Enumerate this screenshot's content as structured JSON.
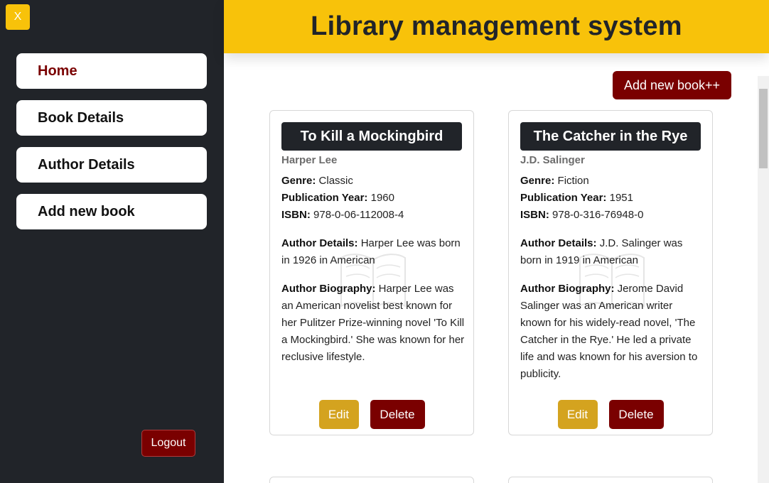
{
  "sidebar": {
    "close_label": "X",
    "items": [
      {
        "label": "Home",
        "active": true
      },
      {
        "label": "Book Details",
        "active": false
      },
      {
        "label": "Author Details",
        "active": false
      },
      {
        "label": "Add new book",
        "active": false
      }
    ],
    "logout_label": "Logout"
  },
  "header": {
    "title": "Library management system"
  },
  "toolbar": {
    "add_book_label": "Add new book++"
  },
  "labels": {
    "genre": "Genre:",
    "year": "Publication Year:",
    "isbn": "ISBN:",
    "author_details": "Author Details:",
    "author_bio": "Author Biography:"
  },
  "books": [
    {
      "title": "To Kill a Mockingbird",
      "author": "Harper Lee",
      "genre": "Classic",
      "year": "1960",
      "isbn": "978-0-06-112008-4",
      "author_details": "Harper Lee was born in 1926 in American",
      "author_bio": "Harper Lee was an American novelist best known for her Pulitzer Prize-winning novel 'To Kill a Mockingbird.' She was known for her reclusive lifestyle.",
      "edit_label": "Edit",
      "delete_label": "Delete"
    },
    {
      "title": "The Catcher in the Rye",
      "author": "J.D. Salinger",
      "genre": "Fiction",
      "year": "1951",
      "isbn": "978-0-316-76948-0",
      "author_details": "J.D. Salinger was born in 1919 in American",
      "author_bio": "Jerome David Salinger was an American writer known for his widely-read novel, 'The Catcher in the Rye.' He led a private life and was known for his aversion to publicity.",
      "edit_label": "Edit",
      "delete_label": "Delete"
    }
  ],
  "colors": {
    "sidebar_bg": "#212429",
    "accent_yellow": "#f8c20a",
    "brand_maroon": "#7a0000",
    "edit_gold": "#d4a31f"
  }
}
